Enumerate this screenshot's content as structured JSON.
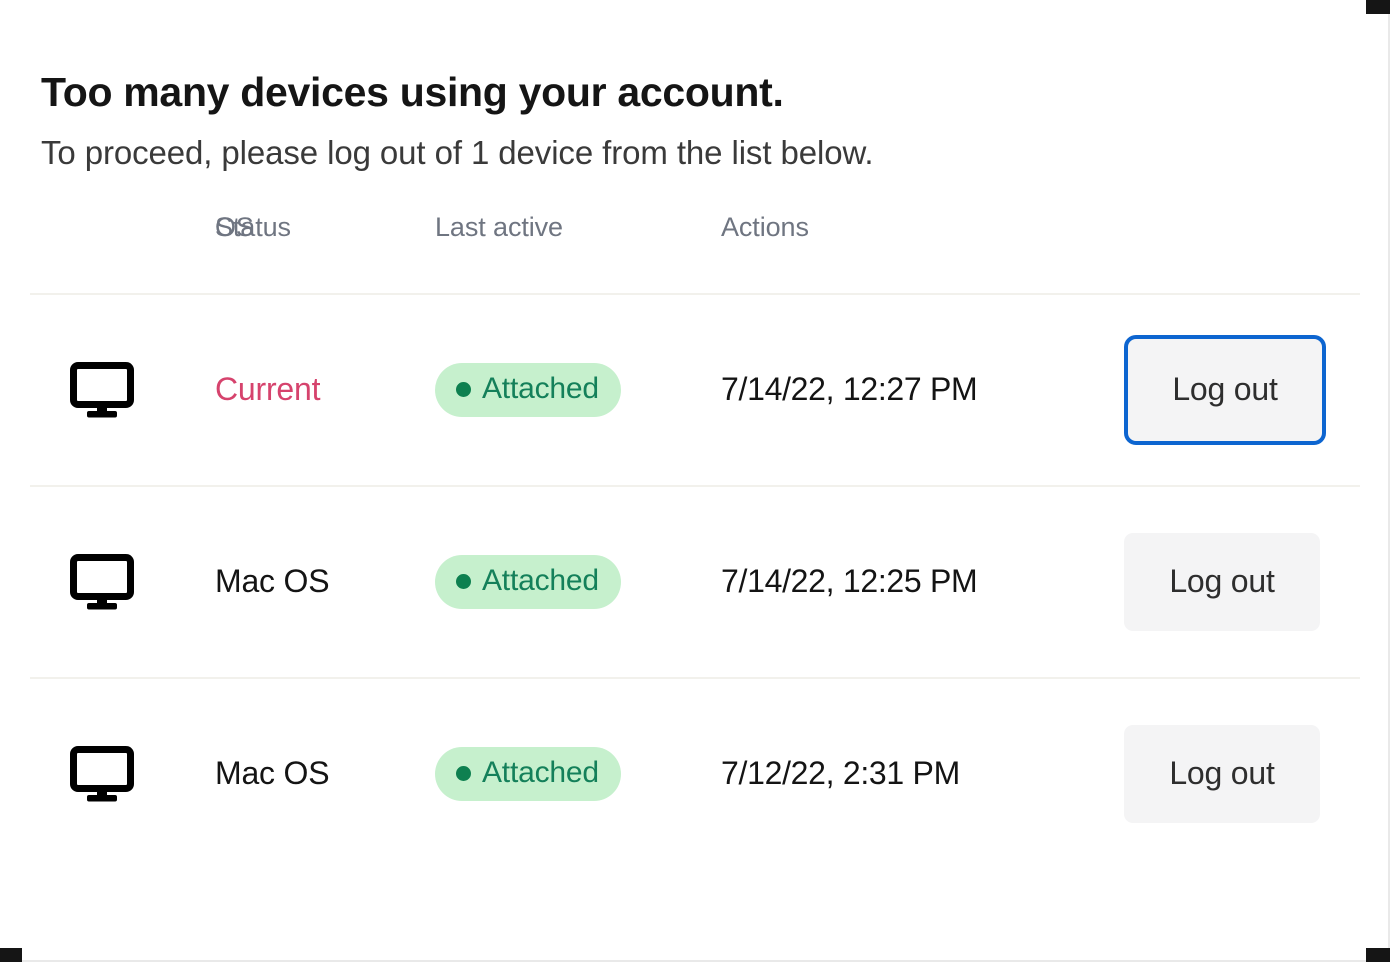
{
  "page": {
    "title": "Too many devices using your account.",
    "subtitle": "To proceed, please log out of 1 device from the list below."
  },
  "table": {
    "columns": {
      "os_icon": "",
      "os": "OS",
      "status": "Status",
      "last_active": "Last active",
      "actions": "Actions"
    },
    "rows": [
      {
        "icon": "monitor-icon",
        "os": "Current",
        "os_is_current": true,
        "status": "Attached",
        "status_dot_color": "#0e8050",
        "status_bg_color": "#c6f0cd",
        "status_text_color": "#14805a",
        "last_active": "7/14/22, 12:27 PM",
        "action_label": "Log out",
        "focused": true
      },
      {
        "icon": "monitor-icon",
        "os": "Mac OS",
        "os_is_current": false,
        "status": "Attached",
        "status_dot_color": "#0e8050",
        "status_bg_color": "#c6f0cd",
        "status_text_color": "#14805a",
        "last_active": "7/14/22, 12:25 PM",
        "action_label": "Log out",
        "focused": false
      },
      {
        "icon": "monitor-icon",
        "os": "Mac OS",
        "os_is_current": false,
        "status": "Attached",
        "status_dot_color": "#0e8050",
        "status_bg_color": "#c6f0cd",
        "status_text_color": "#14805a",
        "last_active": "7/12/22, 2:31 PM",
        "action_label": "Log out",
        "focused": false
      }
    ]
  },
  "colors": {
    "current_text": "#d6436d",
    "focus_ring": "#0d65d0",
    "header_text": "#6f7581",
    "divider": "#f2f1ec",
    "button_bg": "#f4f4f5"
  }
}
